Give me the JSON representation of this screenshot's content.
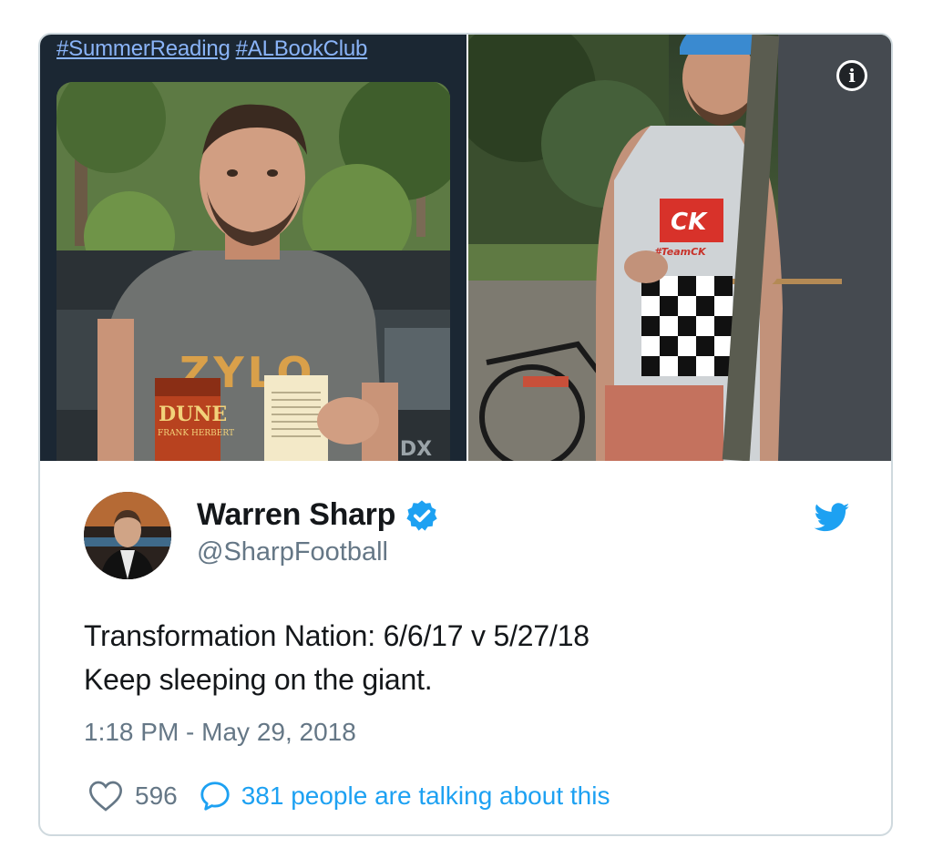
{
  "media": {
    "left_photo": {
      "hashtags": [
        "#SummerReading",
        "#ALBookClub"
      ],
      "book_title": "DUNE",
      "book_author": "FRANK HERBERT",
      "shirt_text": "ZYLO",
      "car_badge": "MDX"
    },
    "right_photo": {
      "shirt_logo": "CK",
      "shirt_text": "#TeamCK"
    },
    "info_icon_label": "i"
  },
  "tweet": {
    "name": "Warren Sharp",
    "handle": "@SharpFootball",
    "text_lines": [
      "Transformation Nation: 6/6/17 v 5/27/18",
      "Keep sleeping on the giant."
    ],
    "timestamp": "1:18 PM - May 29, 2018",
    "likes": "596",
    "talk_label": "381 people are talking about this"
  },
  "colors": {
    "link_blue": "#1da1f2",
    "hashtag_blue": "#8ab4f8",
    "text_dark": "#14171a",
    "text_gray": "#657786",
    "border": "#cfd9de"
  },
  "icons": {
    "verified": "verified-badge-icon",
    "brand": "twitter-bird-icon",
    "like": "heart-icon",
    "reply": "reply-bubble-icon",
    "info": "info-icon"
  }
}
